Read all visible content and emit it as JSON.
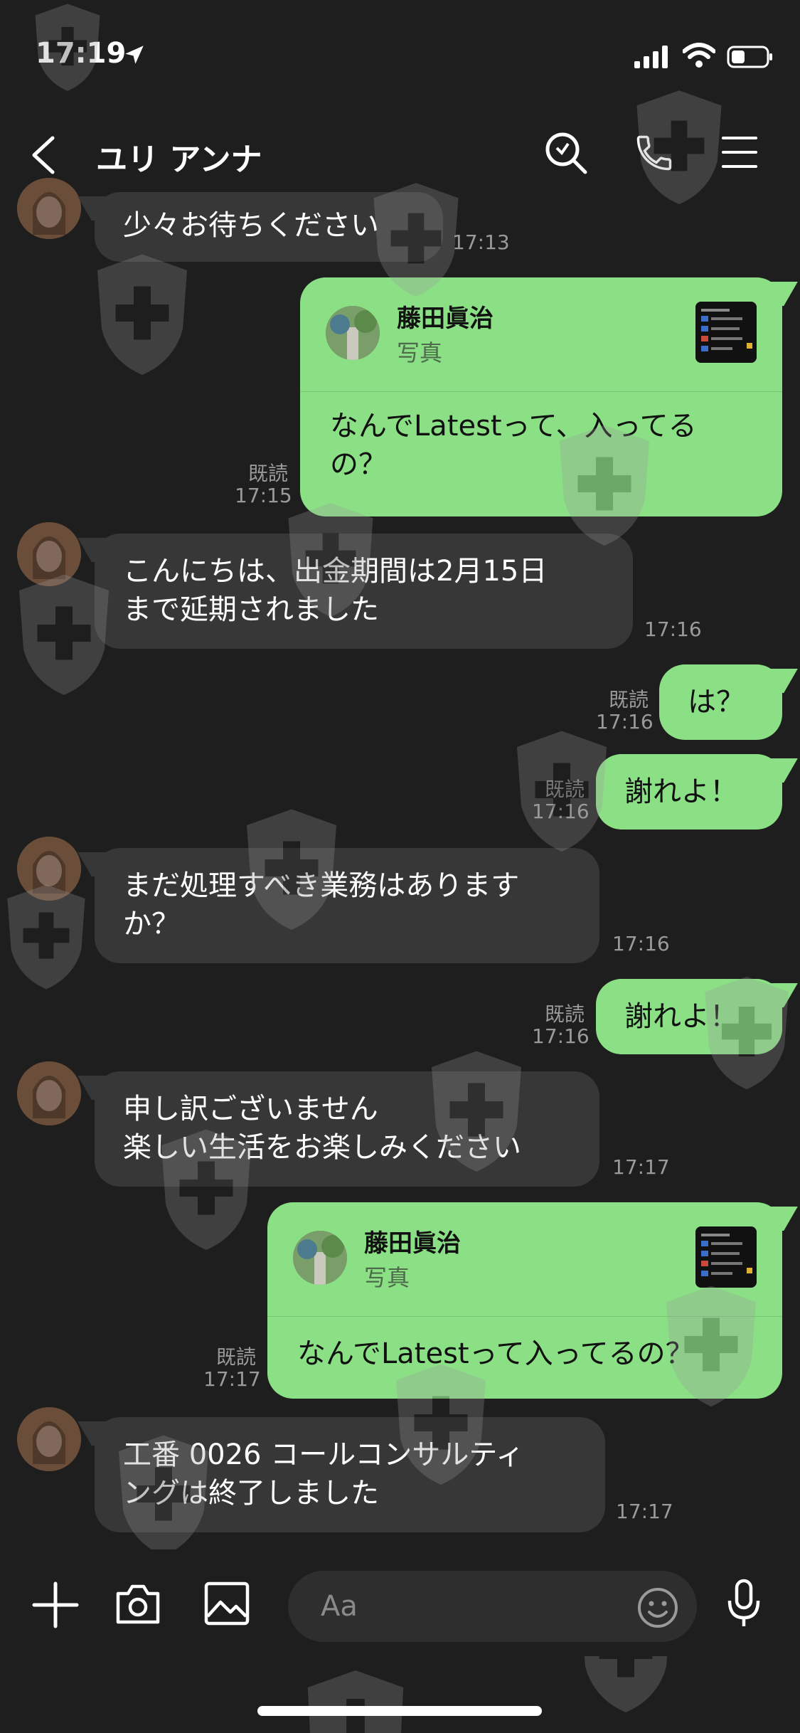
{
  "status_bar": {
    "time": "17:19"
  },
  "header": {
    "title": "ユリ アンナ"
  },
  "messages": [
    {
      "text": "少々お待ちください",
      "time": "17:13"
    },
    {
      "reply_name": "藤田眞治",
      "reply_sub": "写真",
      "text": "なんでLatestって、入ってる\nの？",
      "read": "既読",
      "time": "17:15"
    },
    {
      "text": "こんにちは、出金期間は2月15日\nまで延期されました",
      "time": "17:16"
    },
    {
      "text": "は？",
      "read": "既読",
      "time": "17:16"
    },
    {
      "text": "謝れよ！",
      "read": "既読",
      "time": "17:16"
    },
    {
      "text": "まだ処理すべき業務はありますか？",
      "time": "17:16"
    },
    {
      "text": "謝れよ！",
      "read": "既読",
      "time": "17:16"
    },
    {
      "text": "申し訳ございません\n楽しい生活をお楽しみください",
      "time": "17:17"
    },
    {
      "reply_name": "藤田眞治",
      "reply_sub": "写真",
      "text": "なんでLatestって入ってるの？",
      "read": "既読",
      "time": "17:17"
    },
    {
      "text": "工番 0026 コールコンサルティ\nングは終了しました",
      "time": "17:17"
    }
  ],
  "input": {
    "placeholder": "Aa"
  },
  "icons": [
    "back-icon",
    "search-icon",
    "phone-icon",
    "menu-icon",
    "plus-icon",
    "camera-icon",
    "image-icon",
    "emoji-icon",
    "mic-icon",
    "location-arrow-icon",
    "signal-icon",
    "wifi-icon",
    "battery-icon"
  ],
  "colors": {
    "background": "#1e1e1e",
    "incoming_bubble": "#373737",
    "outgoing_bubble": "#8be086",
    "timestamp": "#9a9a9a"
  }
}
